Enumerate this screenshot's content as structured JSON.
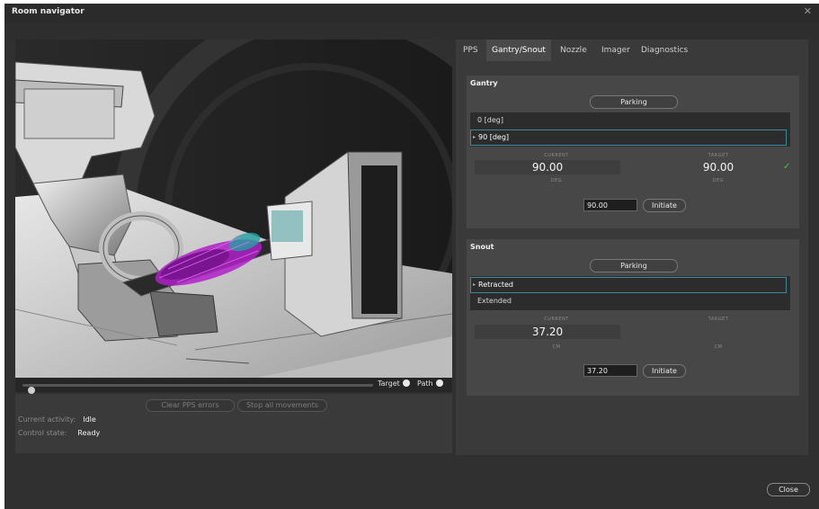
{
  "window": {
    "title": "Room navigator",
    "close_glyph": "✕"
  },
  "viewport": {
    "target_label": "Target",
    "path_label": "Path",
    "slider_value": 0
  },
  "left_panel": {
    "clear_pps_errors": "Clear PPS errors",
    "stop_all_movements": "Stop all movements",
    "current_activity_label": "Current activity:",
    "current_activity_value": "Idle",
    "control_state_label": "Control state:",
    "control_state_value": "Ready"
  },
  "tabs": [
    {
      "label": "PPS",
      "active": false
    },
    {
      "label": "Gantry/Snout",
      "active": true
    },
    {
      "label": "Nozzle",
      "active": false
    },
    {
      "label": "Imager",
      "active": false
    },
    {
      "label": "Diagnostics",
      "active": false
    }
  ],
  "gantry": {
    "title": "Gantry",
    "parking_label": "Parking",
    "options": [
      "0 [deg]",
      "90 [deg]"
    ],
    "selected_index": 1,
    "current_label": "CURRENT",
    "target_label": "TARGET",
    "current_value": "90.00",
    "target_value": "90.00",
    "unit": "DEG",
    "input_value": "90.00",
    "initiate_label": "Initiate",
    "reached_icon": "✓"
  },
  "snout": {
    "title": "Snout",
    "parking_label": "Parking",
    "options": [
      "Retracted",
      "Extended"
    ],
    "selected_index": 0,
    "current_label": "CURRENT",
    "target_label": "TARGET",
    "current_value": "37.20",
    "target_value": "",
    "unit": "CM",
    "input_value": "37.20",
    "initiate_label": "Initiate"
  },
  "footer": {
    "close_label": "Close"
  },
  "colors": {
    "accent_border": "#3a8a9e",
    "check_green": "#4ec04e",
    "patient_magenta": "#b020c8"
  }
}
